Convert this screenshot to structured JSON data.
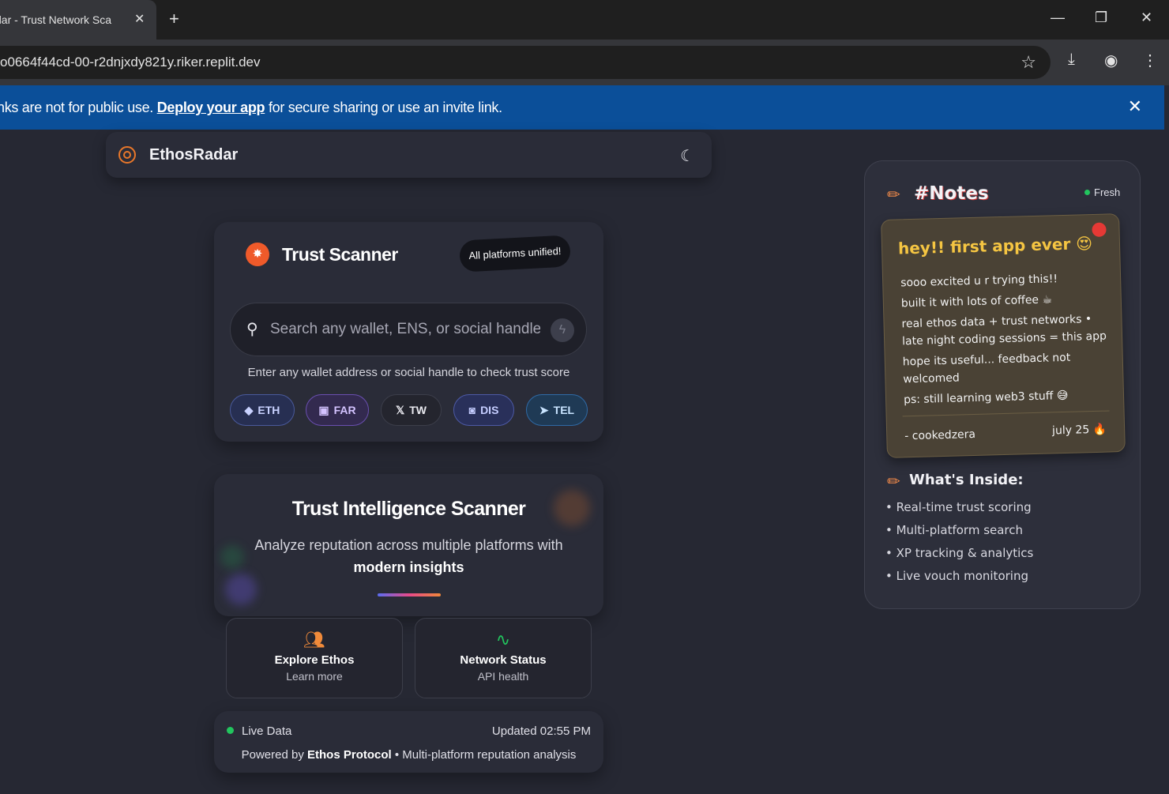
{
  "browser": {
    "tab_title": "dar - Trust Network Sca",
    "url": "o0664f44cd-00-r2dnjxdy821y.riker.replit.dev"
  },
  "banner": {
    "text_before": "nks are not for public use. ",
    "link": "Deploy your app",
    "text_after": " for secure sharing or use an invite link."
  },
  "nav": {
    "brand": "EthosRadar"
  },
  "scanner": {
    "title": "Trust Scanner",
    "badge": "All platforms unified!",
    "search_placeholder": "Search any wallet, ENS, or social handle",
    "hint": "Enter any wallet address or social handle to check trust score",
    "platforms": [
      {
        "label": "ETH",
        "icon": "ethereum-icon"
      },
      {
        "label": "FAR",
        "icon": "farcaster-icon"
      },
      {
        "label": "TW",
        "icon": "x-icon"
      },
      {
        "label": "DIS",
        "icon": "discord-icon"
      },
      {
        "label": "TEL",
        "icon": "telegram-icon"
      }
    ]
  },
  "intel": {
    "title": "Trust Intelligence Scanner",
    "subtitle": "Analyze reputation across multiple platforms with",
    "subtitle_bold": "modern insights"
  },
  "tiles": [
    {
      "title": "Explore Ethos",
      "sub": "Learn more",
      "icon": "users-icon"
    },
    {
      "title": "Network Status",
      "sub": "API health",
      "icon": "activity-icon"
    }
  ],
  "footer": {
    "live": "Live Data",
    "updated": "Updated 02:55 PM",
    "powered_prefix": "Powered by ",
    "powered_brand": "Ethos Protocol",
    "powered_suffix": " • Multi-platform reputation analysis"
  },
  "notes": {
    "title": "#Notes",
    "status": "Fresh",
    "sticky": {
      "heading": "hey!! first app ever 😍",
      "lines": [
        "sooo excited u r trying this!!",
        "built it with lots of coffee ☕",
        "real ethos data + trust networks •",
        "late night coding sessions = this app",
        "hope its useful... feedback not",
        "welcomed",
        "ps: still learning web3 stuff 😅"
      ],
      "signature": "- cookedzera",
      "date": "july 25 🔥"
    },
    "inside_title": "What's Inside:",
    "inside_items": [
      "• Real-time trust scoring",
      "• Multi-platform search",
      "• XP tracking & analytics",
      "• Live vouch monitoring"
    ]
  }
}
